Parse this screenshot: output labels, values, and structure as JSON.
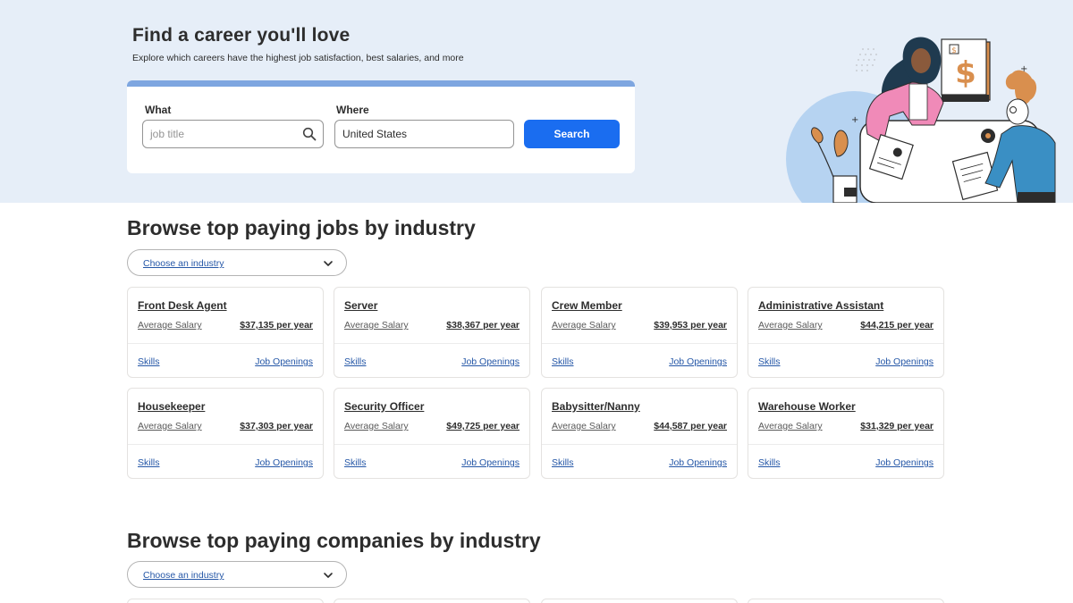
{
  "hero": {
    "title": "Find a career you'll love",
    "subtitle": "Explore which careers have the highest job satisfaction, best salaries, and more"
  },
  "search": {
    "what_label": "What",
    "what_placeholder": "job title",
    "where_label": "Where",
    "where_value": "United States",
    "button_label": "Search"
  },
  "jobs_section": {
    "title": "Browse top paying jobs by industry",
    "dropdown_label": "Choose an industry",
    "salary_label": "Average Salary",
    "skills_label": "Skills",
    "openings_label": "Job Openings",
    "cards": [
      {
        "title": "Front Desk Agent",
        "salary": "$37,135 per year"
      },
      {
        "title": "Server",
        "salary": "$38,367 per year"
      },
      {
        "title": "Crew Member",
        "salary": "$39,953 per year"
      },
      {
        "title": "Administrative Assistant",
        "salary": "$44,215 per year"
      },
      {
        "title": "Housekeeper",
        "salary": "$37,303 per year"
      },
      {
        "title": "Security Officer",
        "salary": "$49,725 per year"
      },
      {
        "title": "Babysitter/Nanny",
        "salary": "$44,587 per year"
      },
      {
        "title": "Warehouse Worker",
        "salary": "$31,329 per year"
      }
    ]
  },
  "companies_section": {
    "title": "Browse top paying companies by industry",
    "dropdown_label": "Choose an industry"
  },
  "colors": {
    "hero_bg": "#e6eef8",
    "accent_blue": "#1a6df0",
    "link_blue": "#2557a7",
    "card_accent": "#7ea6e0"
  },
  "icons": {
    "search": "magnifier-icon",
    "dropdown": "chevron-down-icon"
  }
}
